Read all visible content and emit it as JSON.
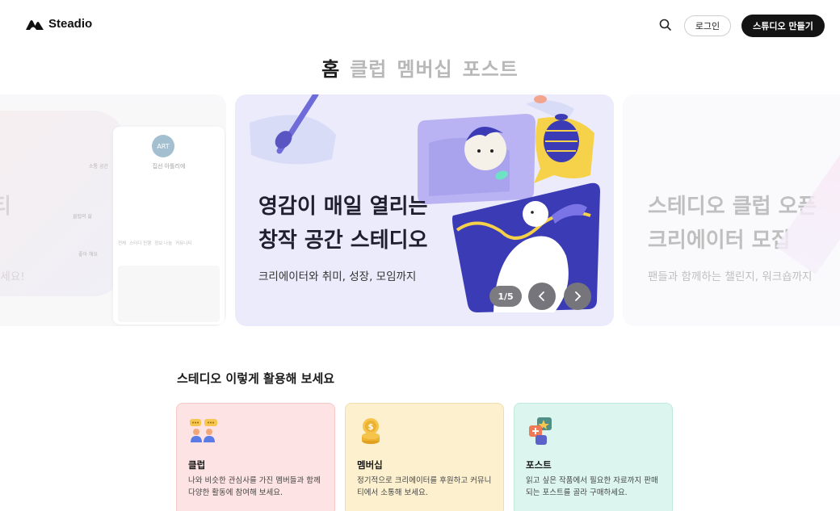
{
  "header": {
    "logo_text": "Steadio",
    "login_label": "로그인",
    "create_label": "스튜디오 만들기"
  },
  "tabs": [
    {
      "label": "홈",
      "active": true
    },
    {
      "label": "클럽",
      "active": false
    },
    {
      "label": "멤버십",
      "active": false
    },
    {
      "label": "포스트",
      "active": false
    }
  ],
  "carousel": {
    "prev": {
      "title": "티",
      "subtitle": "보세요!",
      "mock_card": {
        "avatar_text": "ART",
        "name": "집선 아틀리에",
        "tabs": [
          "전체",
          "스터디 진행",
          "정보 나눔",
          "커뮤니티"
        ],
        "labels": [
          "소통 공간",
          "클럽의 삶",
          "좋아 해요"
        ]
      }
    },
    "current": {
      "title_line1": "영감이 매일 열리는",
      "title_line2": "창작 공간 스테디오",
      "subtitle": "크리에이터와 취미, 성장, 모임까지"
    },
    "next": {
      "title_line1": "스테디오 클럽 오픈",
      "title_line2": "크리에이터 모집",
      "subtitle": "팬들과 함께하는 챌린지, 워크숍까지"
    },
    "counter": "1/5",
    "prev_icon": "chevron-left-icon",
    "next_icon": "chevron-right-icon"
  },
  "section": {
    "title": "스테디오 이렇게 활용해 보세요",
    "cards": [
      {
        "title": "클럽",
        "desc": "나와 비슷한 관심사를 가진 멤버들과 함께 다양한 활동에 참여해 보세요.",
        "icon": "people-icon",
        "color": "#fde3e3"
      },
      {
        "title": "멤버십",
        "desc": "정기적으로 크리에이터를 후원하고 커뮤니티에서 소통해 보세요.",
        "icon": "coin-icon",
        "color": "#fdf0cf"
      },
      {
        "title": "포스트",
        "desc": "읽고 싶은 작품에서 필요한 자료까지 판매되는 포스트를 골라 구매하세요.",
        "icon": "chat-bubbles-icon",
        "color": "#dcf6ef"
      }
    ]
  }
}
